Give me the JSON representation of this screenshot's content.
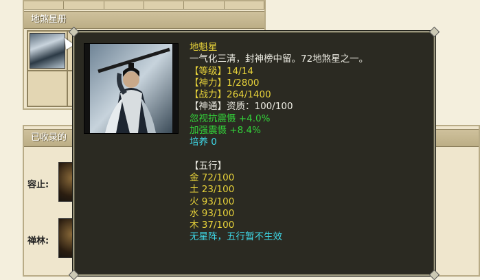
{
  "top_panel": {
    "title": "地煞星册"
  },
  "bottom_panel": {
    "title": "已收录的",
    "rows": [
      {
        "label": "容止:"
      },
      {
        "label": "禅林:"
      }
    ]
  },
  "tooltip": {
    "name": "地魁星",
    "description": "一气化三清，封神榜中留。72地煞星之一。",
    "stats": [
      {
        "label": "【等级】",
        "value": "14/14"
      },
      {
        "label": "【神力】",
        "value": "1/2800"
      },
      {
        "label": "【战力】",
        "value": "264/1400"
      },
      {
        "label": "【神通】",
        "value": "资质：100/100"
      }
    ],
    "effects": [
      {
        "text": "忽视抗震慑 +4.0%"
      },
      {
        "text": "加强震慑 +8.4%"
      }
    ],
    "cultivation": "培养 0",
    "wuxing_header": "【五行】",
    "wuxing": [
      {
        "text": "金 72/100"
      },
      {
        "text": "土 23/100"
      },
      {
        "text": "火 93/100"
      },
      {
        "text": "水 93/100"
      },
      {
        "text": "木 37/100"
      }
    ],
    "footer": "无星阵，五行暂不生效"
  },
  "colors": {
    "tooltip_bg": "#2b2a22",
    "name_yellow": "#e8d33a",
    "effect_green": "#33d23a",
    "info_cyan": "#3ed7e6"
  }
}
